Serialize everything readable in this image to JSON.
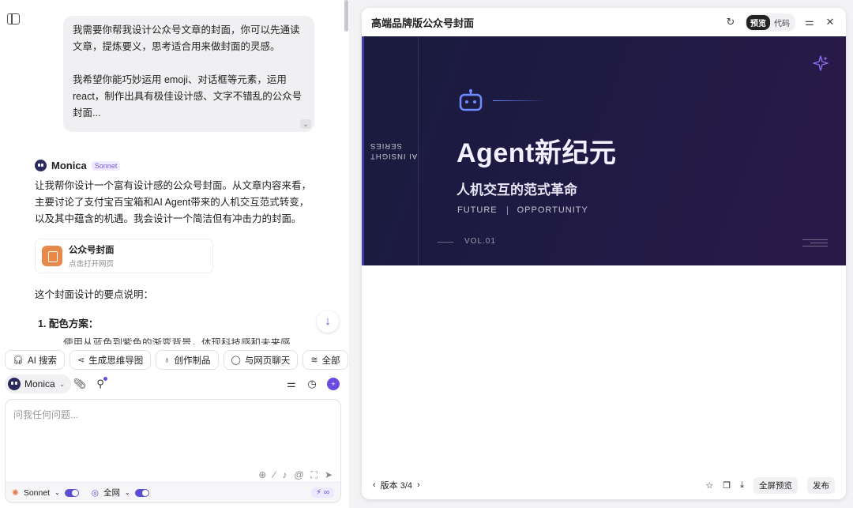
{
  "chat": {
    "user_message": {
      "paragraph1": "我需要你帮我设计公众号文章的封面，你可以先通读文章，提炼要义，思考适合用来做封面的灵感。",
      "paragraph2": "我希望你能巧妙运用 emoji、对话框等元素，运用 react，制作出具有极佳设计感、文字不错乱的公众号封面..."
    },
    "assistant": {
      "name": "Monica",
      "model_badge": "Sonnet",
      "intro": "让我帮你设计一个富有设计感的公众号封面。从文章内容来看，主要讨论了支付宝百宝箱和AI Agent带来的人机交互范式转变，以及其中蕴含的机遇。我会设计一个简洁但有冲击力的封面。",
      "artifact_title": "公众号封面",
      "artifact_subtitle": "点击打开网页",
      "explain": "这个封面设计的要点说明：",
      "list_item1": "1. 配色方案：",
      "list_sub1": "使用从蓝色到紫色的渐变背景，体现科技感和未来感"
    }
  },
  "tools": {
    "chips": [
      {
        "icon": "headphones-icon",
        "label": "AI 搜索"
      },
      {
        "icon": "mindmap-icon",
        "label": "生成思维导图"
      },
      {
        "icon": "bulb-icon",
        "label": "创作制品"
      },
      {
        "icon": "chat-bubble-icon",
        "label": "与网页聊天"
      },
      {
        "icon": "layers-icon",
        "label": "全部"
      }
    ],
    "bot_select": "Monica"
  },
  "input": {
    "placeholder": "问我任何问题...",
    "footer_model": "Sonnet",
    "footer_web": "全网",
    "footer_badge": "∞"
  },
  "panel": {
    "title": "高端品牌版公众号封面",
    "tab_preview": "预览",
    "tab_code": "代码",
    "version": "版本 3/4",
    "btn_fullscreen": "全屏预览",
    "btn_publish": "发布"
  },
  "cover": {
    "series_line1": "AI INSIGHT",
    "series_line2": "SERIES",
    "title": "Agent新纪元",
    "subtitle": "人机交互的范式革命",
    "tag1": "FUTURE",
    "tag2": "OPPORTUNITY",
    "vol": "VOL.01",
    "accent": "#6f8cff"
  }
}
